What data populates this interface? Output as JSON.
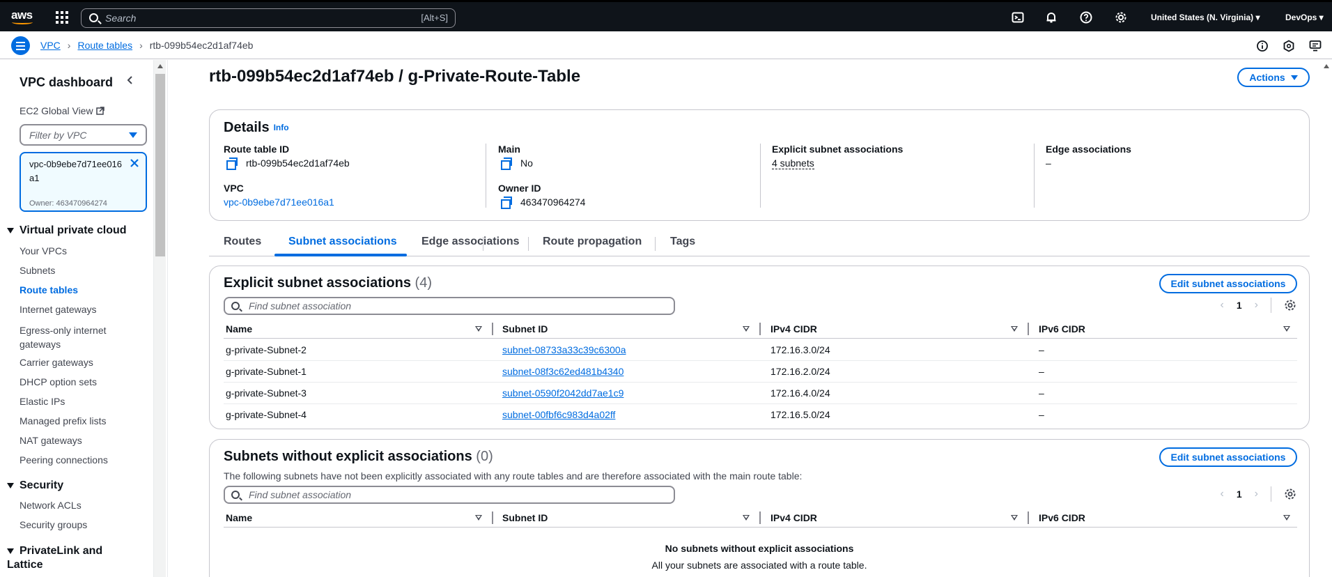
{
  "topnav": {
    "logo": "aws",
    "search_placeholder": "Search",
    "search_shortcut": "[Alt+S]",
    "region": "United States (N. Virginia) ▾",
    "account": "DevOps ▾"
  },
  "breadcrumbs": {
    "items": [
      "VPC",
      "Route tables",
      "rtb-099b54ec2d1af74eb"
    ]
  },
  "sidenav": {
    "title": "VPC dashboard",
    "global_view": "EC2 Global View",
    "filter_placeholder": "Filter by VPC",
    "vpc_token": "vpc-0b9ebe7d71ee016a1",
    "vpc_owner": "Owner: 463470964274",
    "sections": [
      {
        "title": "Virtual private cloud",
        "items": [
          "Your VPCs",
          "Subnets",
          "Route tables",
          "Internet gateways",
          "Egress-only internet gateways",
          "Carrier gateways",
          "DHCP option sets",
          "Elastic IPs",
          "Managed prefix lists",
          "NAT gateways",
          "Peering connections"
        ]
      },
      {
        "title": "Security",
        "items": [
          "Network ACLs",
          "Security groups"
        ]
      },
      {
        "title": "PrivateLink and Lattice",
        "items": []
      }
    ],
    "active_item": "Route tables"
  },
  "page": {
    "title": "rtb-099b54ec2d1af74eb / g-Private-Route-Table",
    "actions_label": "Actions"
  },
  "details": {
    "title": "Details",
    "info": "Info",
    "route_table_id_label": "Route table ID",
    "route_table_id": "rtb-099b54ec2d1af74eb",
    "main_label": "Main",
    "main": "No",
    "explicit_label": "Explicit subnet associations",
    "explicit": "4 subnets",
    "edge_label": "Edge associations",
    "edge": "–",
    "vpc_label": "VPC",
    "vpc": "vpc-0b9ebe7d71ee016a1",
    "owner_label": "Owner ID",
    "owner": "463470964274"
  },
  "tabs": [
    "Routes",
    "Subnet associations",
    "Edge associations",
    "Route propagation",
    "Tags"
  ],
  "active_tab": "Subnet associations",
  "explicit_table": {
    "title": "Explicit subnet associations",
    "count": "(4)",
    "edit_label": "Edit subnet associations",
    "filter_placeholder": "Find subnet association",
    "page": "1",
    "columns": [
      "Name",
      "Subnet ID",
      "IPv4 CIDR",
      "IPv6 CIDR"
    ],
    "rows": [
      {
        "name": "g-private-Subnet-2",
        "subnet_id": "subnet-08733a33c39c6300a",
        "ipv4": "172.16.3.0/24",
        "ipv6": "–"
      },
      {
        "name": "g-private-Subnet-1",
        "subnet_id": "subnet-08f3c62ed481b4340",
        "ipv4": "172.16.2.0/24",
        "ipv6": "–"
      },
      {
        "name": "g-private-Subnet-3",
        "subnet_id": "subnet-0590f2042dd7ae1c9",
        "ipv4": "172.16.4.0/24",
        "ipv6": "–"
      },
      {
        "name": "g-private-Subnet-4",
        "subnet_id": "subnet-00fbf6c983d4a02ff",
        "ipv4": "172.16.5.0/24",
        "ipv6": "–"
      }
    ]
  },
  "implicit_table": {
    "title": "Subnets without explicit associations",
    "count": "(0)",
    "edit_label": "Edit subnet associations",
    "description": "The following subnets have not been explicitly associated with any route tables and are therefore associated with the main route table:",
    "filter_placeholder": "Find subnet association",
    "page": "1",
    "columns": [
      "Name",
      "Subnet ID",
      "IPv4 CIDR",
      "IPv6 CIDR"
    ],
    "empty_title": "No subnets without explicit associations",
    "empty_desc": "All your subnets are associated with a route table."
  }
}
